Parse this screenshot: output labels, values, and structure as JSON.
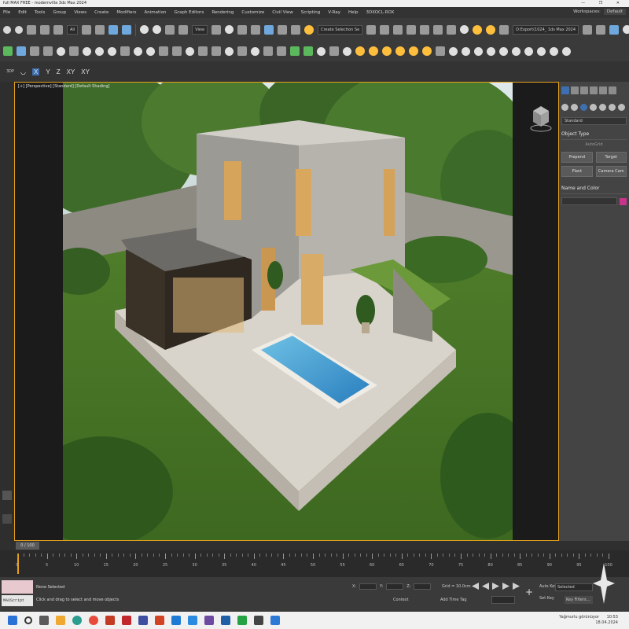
{
  "window": {
    "title": "full MAX FREE - modernvilla 3ds Max 2024",
    "controls": "— ❐ ✕"
  },
  "menu": {
    "items": [
      "File",
      "Edit",
      "Tools",
      "Group",
      "Views",
      "Create",
      "Modifiers",
      "Animation",
      "Graph Editors",
      "Rendering",
      "Customize",
      "Civil View",
      "Scripting",
      "V-Ray",
      "Help",
      "3DXOCL.ROX"
    ],
    "workspace_label": "Workspaces:",
    "workspace_value": "Default"
  },
  "toolbar": {
    "selection_filter": "All",
    "view_dropdown": "View",
    "named_selection": "Create Selection Se",
    "render_dropdown": "D:Export(1024_ 1ds Max 2024"
  },
  "axis": {
    "prefix": "3DP",
    "x": "X",
    "y": "Y",
    "z": "Z",
    "xy": "XY",
    "xy2": "XY"
  },
  "viewport": {
    "label": "[+] [Perspective] [Standard] [Default Shading]"
  },
  "command_panel": {
    "dropdown": "Standard",
    "object_type_header": "Object Type",
    "autogrid": "AutoGrid",
    "buttons": [
      "Prepend",
      "Target",
      "Plant",
      "Camera Cam"
    ],
    "name_color_header": "Name and Color"
  },
  "timeline": {
    "frame_display": "0 / 100",
    "ticks": [
      "0",
      "5",
      "10",
      "15",
      "20",
      "25",
      "30",
      "35",
      "40",
      "45",
      "50",
      "55",
      "60",
      "65",
      "70",
      "75",
      "80",
      "85",
      "90",
      "95",
      "100"
    ]
  },
  "status": {
    "maxscript": "MAXScript Mini",
    "selection": "None Selected",
    "prompt": "Click and drag to select and move objects",
    "x_label": "X:",
    "y_label": "Y:",
    "z_label": "Z:",
    "grid": "Grid = 10.0cm",
    "context": "Context",
    "add_time_tag": "Add Time Tag",
    "auto_key": "Auto Key",
    "set_key": "Set Key",
    "selected_dropdown": "Selected",
    "key_filters": "Key Filters..."
  },
  "taskbar": {
    "tray": "Yağmurlu görünüyor",
    "time": "10:53",
    "date": "18.04.2024"
  }
}
